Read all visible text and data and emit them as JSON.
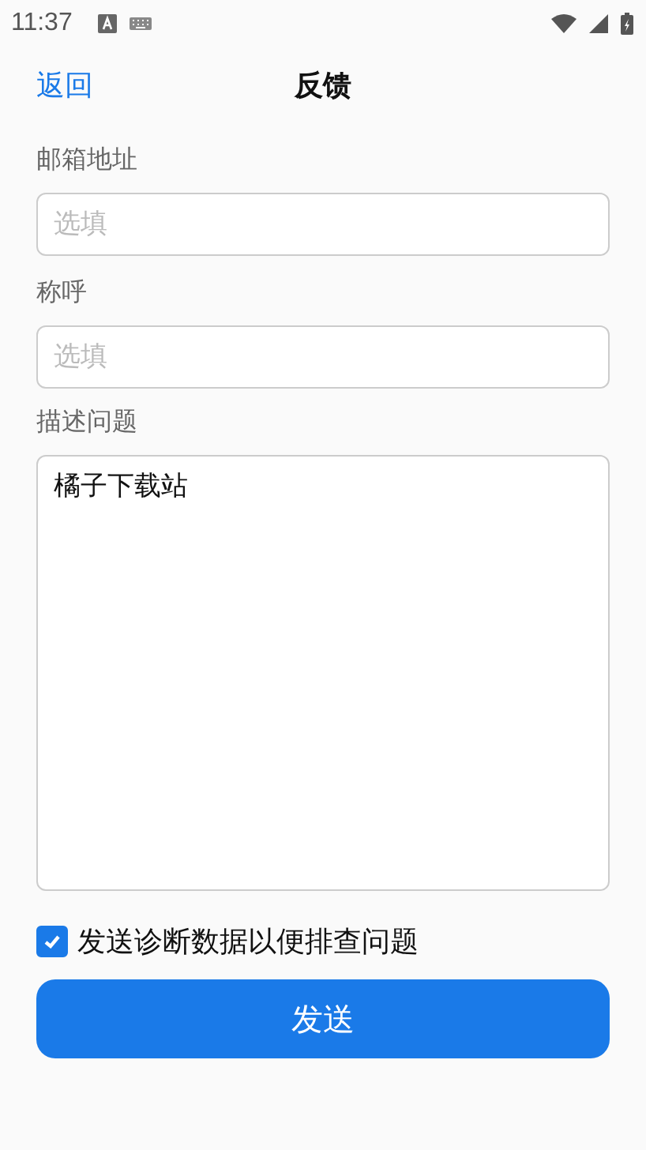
{
  "status_bar": {
    "time": "11:37"
  },
  "header": {
    "back": "返回",
    "title": "反馈"
  },
  "fields": [
    {
      "kind": "input",
      "label": "邮箱地址",
      "placeholder": "选填"
    },
    {
      "kind": "input",
      "label": "称呼",
      "placeholder": "选填"
    },
    {
      "kind": "textarea",
      "label": "描述问题",
      "value": "橘子下载站"
    }
  ],
  "diagnostics": {
    "label": "发送诊断数据以便排查问题",
    "checked": true
  },
  "submit": "发送"
}
